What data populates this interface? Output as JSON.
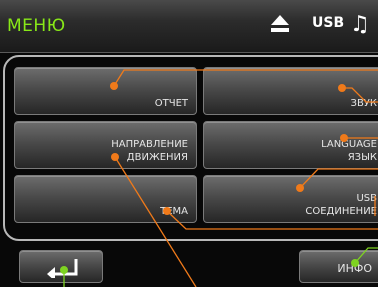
{
  "header": {
    "title": "МЕНЮ",
    "icons": [
      "eject-icon",
      "usb-icon",
      "music-note-icon"
    ],
    "usb_label": "USB",
    "music_glyph": "♫"
  },
  "menu": {
    "report": "ОТЧЕТ",
    "sound": "ЗВУК",
    "route_line1": "НАПРАВЛЕНИЕ",
    "route_line2": "ДВИЖЕНИЯ",
    "language_line1": "LANGUAGE",
    "language_line2": "ЯЗЫК",
    "theme": "ТЕМА",
    "usb_line1": "USB",
    "usb_line2": "СОЕДИНЕНИЕ"
  },
  "footer": {
    "back_icon": "back-arrow-icon",
    "info": "ИНФО"
  },
  "colors": {
    "title": "#88e818",
    "callout": "#f07a1a",
    "callout_green": "#7ed321"
  }
}
